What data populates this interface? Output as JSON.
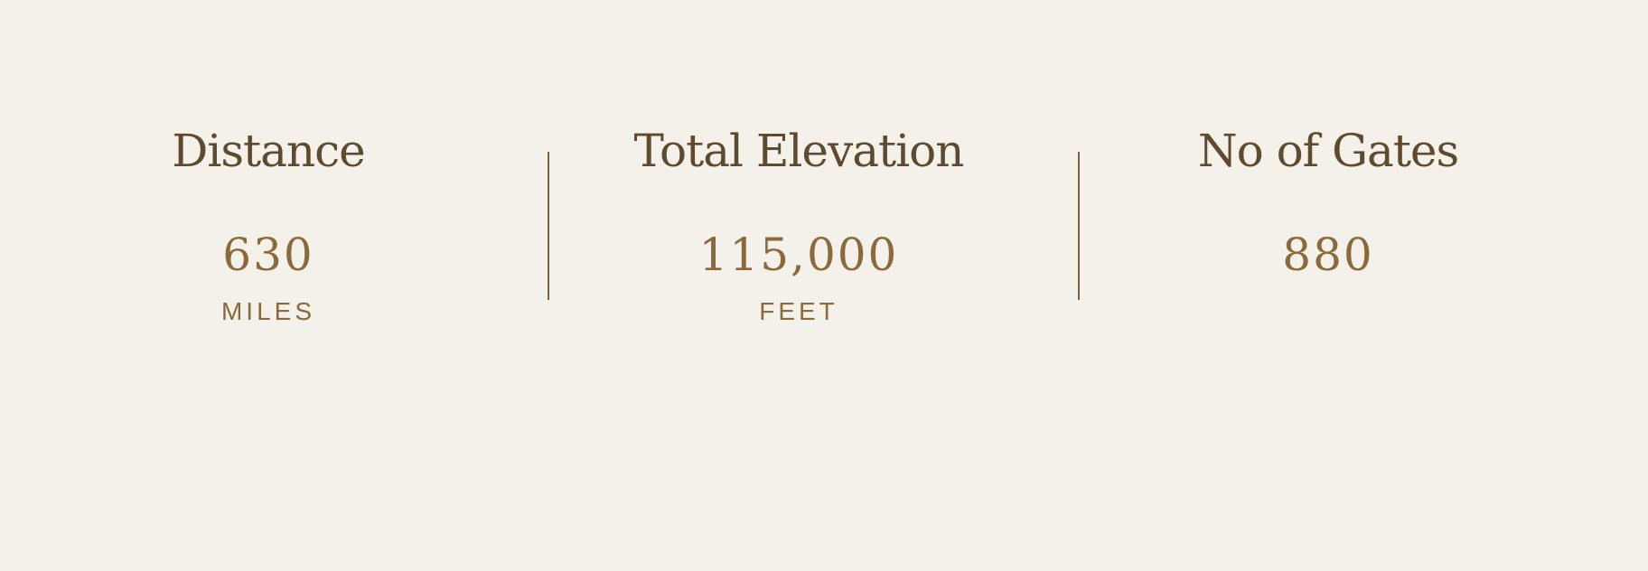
{
  "stats": [
    {
      "heading": "Distance",
      "value": "630",
      "unit": "MILES"
    },
    {
      "heading": "Total Elevation",
      "value": "115,000",
      "unit": "FEET"
    },
    {
      "heading": "No of Gates",
      "value": "880",
      "unit": ""
    }
  ],
  "colors": {
    "background": "#f4f1ea",
    "heading": "#5e4a2e",
    "value": "#8a6a3a",
    "divider": "#7a6240"
  }
}
